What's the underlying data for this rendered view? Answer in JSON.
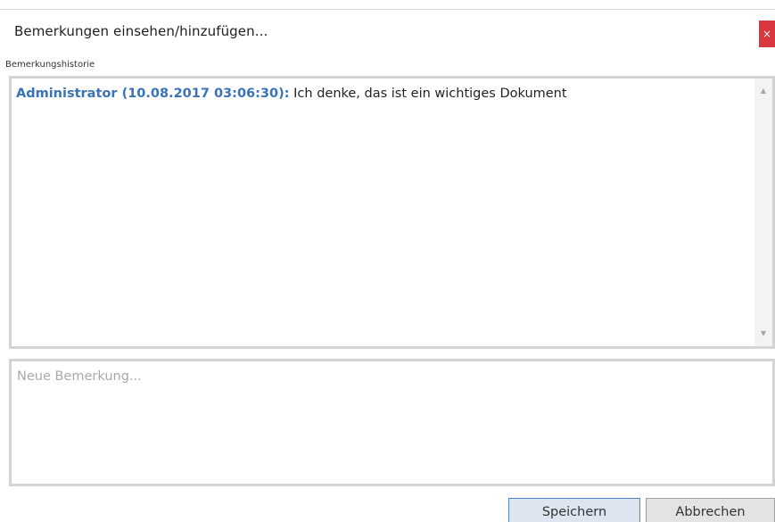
{
  "dialog": {
    "title": "Bemerkungen einsehen/hinzufügen...",
    "close_label": "×"
  },
  "history": {
    "section_label": "Bemerkungshistorie",
    "entries": [
      {
        "author_stamp": "Administrator (10.08.2017 03:06:30):",
        "text": " Ich denke, das ist ein wichtiges Dokument"
      }
    ],
    "scroll_up_glyph": "▲",
    "scroll_down_glyph": "▼"
  },
  "new_remark": {
    "placeholder": "Neue Bemerkung...",
    "value": ""
  },
  "buttons": {
    "save_label": "Speichern",
    "cancel_label": "Abbrechen"
  }
}
